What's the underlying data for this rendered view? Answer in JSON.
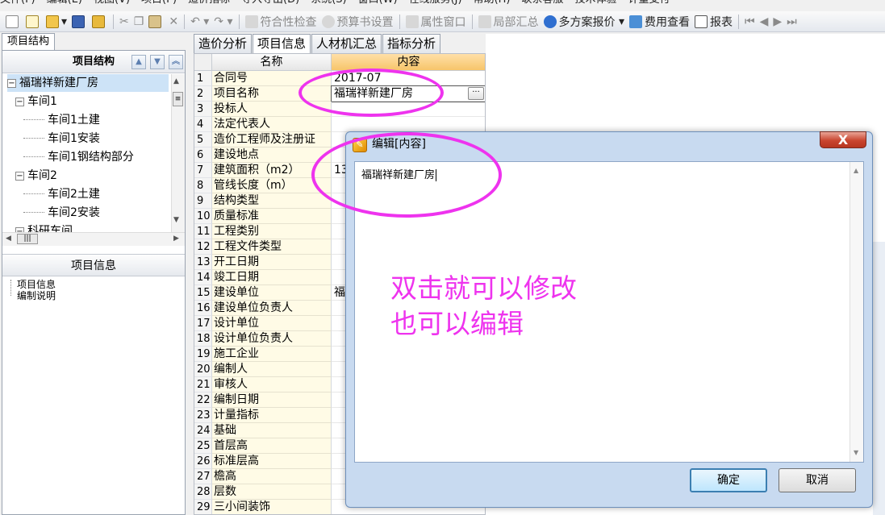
{
  "menubar": {
    "items": [
      "文件(F)",
      "编辑(E)",
      "视图(V)",
      "项目(P)",
      "造价指标",
      "导入导出(D)",
      "系统(S)",
      "窗口(W)",
      "在线服务(J)",
      "帮助(H)",
      "联系客服",
      "技术体验",
      "计量支付"
    ]
  },
  "toolbar": {
    "items": [
      {
        "label": "符合性检查",
        "icon": "check-icon",
        "enabled": false
      },
      {
        "label": "预算书设置",
        "icon": "settings-icon",
        "enabled": false
      },
      {
        "label": "属性窗口",
        "icon": "window-icon",
        "enabled": false
      },
      {
        "label": "局部汇总",
        "icon": "sum-icon",
        "enabled": false
      },
      {
        "label": "多方案报价",
        "icon": "quote-icon",
        "enabled": true
      },
      {
        "label": "费用查看",
        "icon": "fee-icon",
        "enabled": true
      },
      {
        "label": "报表",
        "icon": "report-icon",
        "enabled": true
      }
    ]
  },
  "left_panel": {
    "tab_label": "项目结构",
    "tree_header": "项目结构",
    "tree": [
      {
        "label": "福瑞祥新建厂房",
        "level": 0,
        "toggle": "−",
        "selected": true
      },
      {
        "label": "车间1",
        "level": 1,
        "toggle": "−"
      },
      {
        "label": "车间1土建",
        "level": 2
      },
      {
        "label": "车间1安装",
        "level": 2
      },
      {
        "label": "车间1钢结构部分",
        "level": 2
      },
      {
        "label": "车间2",
        "level": 1,
        "toggle": "−"
      },
      {
        "label": "车间2土建",
        "level": 2
      },
      {
        "label": "车间2安装",
        "level": 2
      },
      {
        "label": "科研车间",
        "level": 1,
        "toggle": "−"
      }
    ],
    "info_header": "项目信息",
    "info_items": [
      "项目信息",
      "编制说明"
    ]
  },
  "main_tabs": [
    {
      "label": "造价分析",
      "active": false
    },
    {
      "label": "项目信息",
      "active": true
    },
    {
      "label": "人材机汇总",
      "active": false
    },
    {
      "label": "指标分析",
      "active": false
    }
  ],
  "grid": {
    "headers": {
      "name": "名称",
      "value": "内容"
    },
    "rows": [
      {
        "num": "1",
        "name": "合同号",
        "value": "2017-07"
      },
      {
        "num": "2",
        "name": "项目名称",
        "value": "福瑞祥新建厂房",
        "editing": true
      },
      {
        "num": "3",
        "name": "投标人",
        "value": ""
      },
      {
        "num": "4",
        "name": "法定代表人",
        "value": ""
      },
      {
        "num": "5",
        "name": "造价工程师及注册证",
        "value": ""
      },
      {
        "num": "6",
        "name": "建设地点",
        "value": ""
      },
      {
        "num": "7",
        "name": "建筑面积（m2）",
        "value": "13"
      },
      {
        "num": "8",
        "name": "管线长度（m）",
        "value": ""
      },
      {
        "num": "9",
        "name": "结构类型",
        "value": ""
      },
      {
        "num": "10",
        "name": "质量标准",
        "value": ""
      },
      {
        "num": "11",
        "name": "工程类别",
        "value": ""
      },
      {
        "num": "12",
        "name": "工程文件类型",
        "value": ""
      },
      {
        "num": "13",
        "name": "开工日期",
        "value": ""
      },
      {
        "num": "14",
        "name": "竣工日期",
        "value": ""
      },
      {
        "num": "15",
        "name": "建设单位",
        "value": "福"
      },
      {
        "num": "16",
        "name": "建设单位负责人",
        "value": ""
      },
      {
        "num": "17",
        "name": "设计单位",
        "value": ""
      },
      {
        "num": "18",
        "name": "设计单位负责人",
        "value": ""
      },
      {
        "num": "19",
        "name": "施工企业",
        "value": ""
      },
      {
        "num": "20",
        "name": "编制人",
        "value": ""
      },
      {
        "num": "21",
        "name": "审核人",
        "value": ""
      },
      {
        "num": "22",
        "name": "编制日期",
        "value": ""
      },
      {
        "num": "23",
        "name": "计量指标",
        "value": ""
      },
      {
        "num": "24",
        "name": "基础",
        "value": ""
      },
      {
        "num": "25",
        "name": "首层高",
        "value": ""
      },
      {
        "num": "26",
        "name": "标准层高",
        "value": ""
      },
      {
        "num": "27",
        "name": "檐高",
        "value": ""
      },
      {
        "num": "28",
        "name": "层数",
        "value": ""
      },
      {
        "num": "29",
        "name": "三小间装饰",
        "value": ""
      }
    ]
  },
  "dialog": {
    "title": "编辑[内容]",
    "content": "福瑞祥新建厂房",
    "ok_label": "确定",
    "cancel_label": "取消",
    "close_label": "X"
  },
  "annotation": {
    "line1": "双击就可以修改",
    "line2": "也可以编辑",
    "color": "#ee33ee"
  }
}
